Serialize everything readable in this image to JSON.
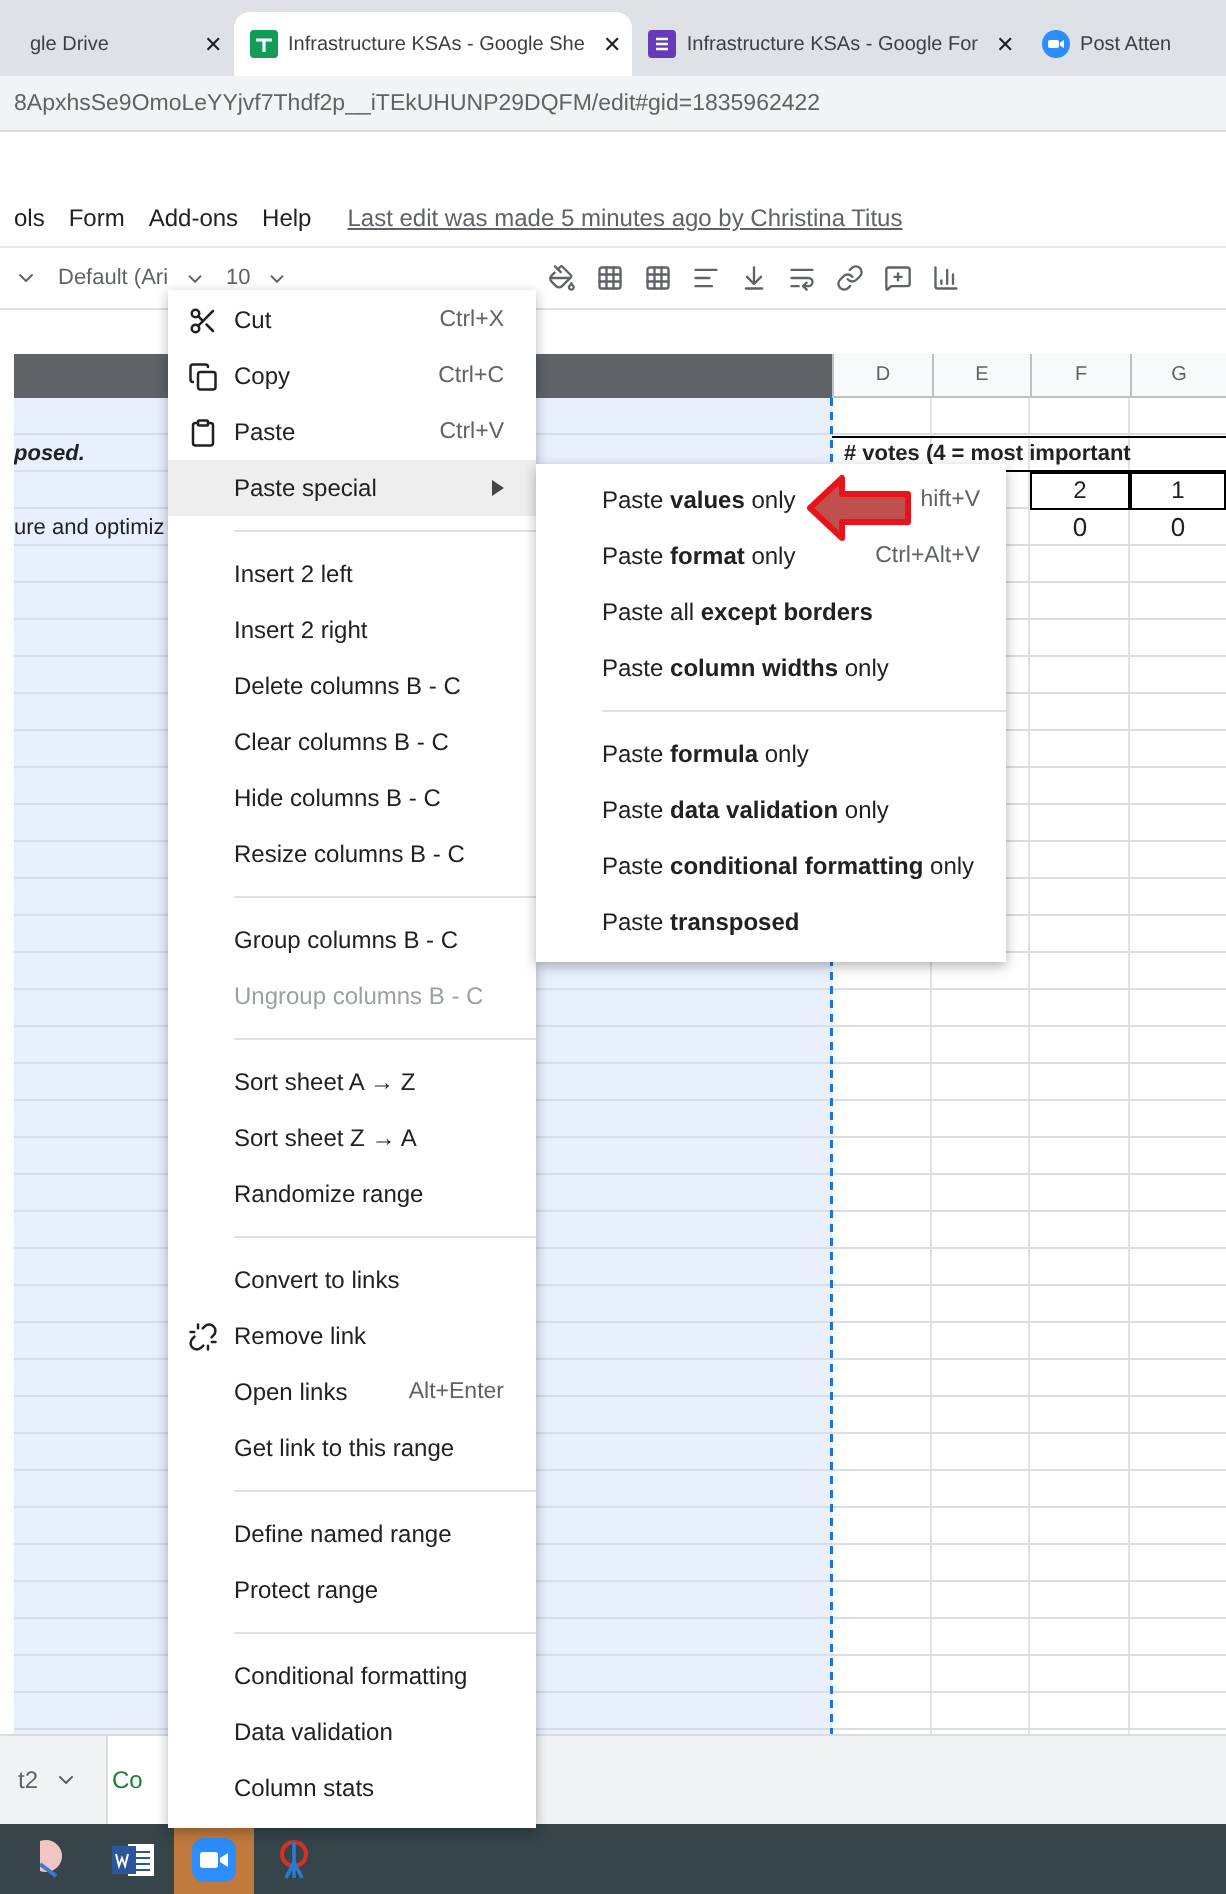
{
  "browser_tabs": [
    {
      "title": "gle Drive",
      "kind": "plain",
      "selected": false,
      "close": "✕"
    },
    {
      "title": "Infrastructure KSAs - Google She",
      "kind": "sheets",
      "selected": true,
      "close": "✕"
    },
    {
      "title": "Infrastructure KSAs - Google For",
      "kind": "forms",
      "selected": false,
      "close": "✕"
    },
    {
      "title": "Post Atten",
      "kind": "zoom",
      "selected": false
    }
  ],
  "address": "8ApxhsSe9OmoLeYYjvf7Thdf2p__iTEkUHUNP29DQFM/edit#gid=1835962422",
  "menubar": {
    "items": [
      "ols",
      "Form",
      "Add-ons",
      "Help"
    ],
    "last_edit": "Last edit was made 5 minutes ago by Christina Titus"
  },
  "toolbar": {
    "font": "Default (Ari",
    "size": "10"
  },
  "sheet": {
    "columns": [
      "",
      "D",
      "E",
      "F",
      "G"
    ],
    "rows": [
      {
        "kind": "plain",
        "cells": [
          "",
          "",
          "",
          "",
          ""
        ]
      },
      {
        "kind": "heading",
        "cells": [
          "posed.",
          "# votes (4 = most important",
          "",
          "",
          ""
        ]
      },
      {
        "kind": "boxed",
        "cells": [
          "",
          "",
          "",
          "2",
          "1"
        ]
      },
      {
        "kind": "plain",
        "cells": [
          "ure and optimiz",
          "",
          "",
          "0",
          "0"
        ]
      }
    ]
  },
  "sheet_tabs": [
    {
      "label": "t2",
      "selected": false
    },
    {
      "label": "Co",
      "selected": true
    }
  ],
  "context_menu": [
    {
      "kind": "cut",
      "label": "Cut",
      "shortcut": "Ctrl+X",
      "disabled": false,
      "selected": false
    },
    {
      "kind": "copy",
      "label": "Copy",
      "shortcut": "Ctrl+C",
      "disabled": false,
      "selected": false
    },
    {
      "kind": "paste",
      "label": "Paste",
      "shortcut": "Ctrl+V",
      "disabled": false,
      "selected": false
    },
    {
      "kind": "submenu",
      "label": "Paste special",
      "disabled": false,
      "selected": true
    },
    {
      "kind": "divider"
    },
    {
      "kind": "item",
      "label": "Insert 2 left",
      "disabled": false,
      "selected": false
    },
    {
      "kind": "item",
      "label": "Insert 2 right",
      "disabled": false,
      "selected": false
    },
    {
      "kind": "item",
      "label": "Delete columns B - C",
      "disabled": false,
      "selected": false
    },
    {
      "kind": "item",
      "label": "Clear columns B - C",
      "disabled": false,
      "selected": false
    },
    {
      "kind": "item",
      "label": "Hide columns B - C",
      "disabled": false,
      "selected": false
    },
    {
      "kind": "item",
      "label": "Resize columns B - C",
      "disabled": false,
      "selected": false
    },
    {
      "kind": "divider"
    },
    {
      "kind": "item",
      "label": "Group columns B - C",
      "disabled": false,
      "selected": false
    },
    {
      "kind": "item",
      "label": "Ungroup columns B - C",
      "disabled": true,
      "selected": false
    },
    {
      "kind": "divider"
    },
    {
      "kind": "item",
      "label": "Sort sheet A → Z",
      "disabled": false,
      "selected": false
    },
    {
      "kind": "item",
      "label": "Sort sheet Z → A",
      "disabled": false,
      "selected": false
    },
    {
      "kind": "item",
      "label": "Randomize range",
      "disabled": false,
      "selected": false
    },
    {
      "kind": "divider"
    },
    {
      "kind": "item",
      "label": "Convert to links",
      "disabled": false,
      "selected": false
    },
    {
      "kind": "unlink",
      "label": "Remove link",
      "disabled": false,
      "selected": false
    },
    {
      "kind": "item",
      "label": "Open links",
      "shortcut": "Alt+Enter",
      "disabled": false,
      "selected": false
    },
    {
      "kind": "item",
      "label": "Get link to this range",
      "disabled": false,
      "selected": false
    },
    {
      "kind": "divider"
    },
    {
      "kind": "item",
      "label": "Define named range",
      "disabled": false,
      "selected": false
    },
    {
      "kind": "item",
      "label": "Protect range",
      "disabled": false,
      "selected": false
    },
    {
      "kind": "divider"
    },
    {
      "kind": "item",
      "label": "Conditional formatting",
      "disabled": false,
      "selected": false
    },
    {
      "kind": "item",
      "label": "Data validation",
      "disabled": false,
      "selected": false
    },
    {
      "kind": "item",
      "label": "Column stats",
      "disabled": false,
      "selected": false
    }
  ],
  "submenu": [
    {
      "kind": "item",
      "label": "Paste **values** only",
      "shortcut": "hift+V"
    },
    {
      "kind": "item",
      "label": "Paste **format** only",
      "shortcut": "Ctrl+Alt+V"
    },
    {
      "kind": "item",
      "label": "Paste all **except borders**"
    },
    {
      "kind": "item",
      "label": "Paste **column widths** only"
    },
    {
      "kind": "divider"
    },
    {
      "kind": "item",
      "label": "Paste **formula** only"
    },
    {
      "kind": "item",
      "label": "Paste **data validation** only"
    },
    {
      "kind": "item",
      "label": "Paste **conditional formatting** only"
    },
    {
      "kind": "item",
      "label": "Paste **transposed**"
    }
  ],
  "taskbar": [
    {
      "kind": "app",
      "active": false
    },
    {
      "kind": "word",
      "active": false
    },
    {
      "kind": "zoom",
      "active": true
    },
    {
      "kind": "snip",
      "active": false
    }
  ]
}
